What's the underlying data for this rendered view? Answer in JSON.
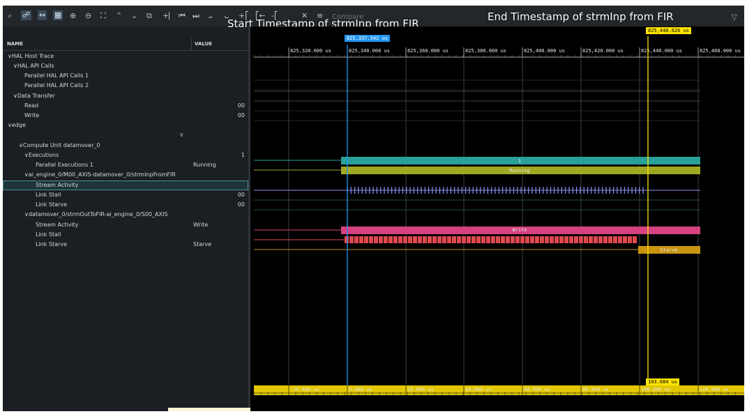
{
  "toolbar": {
    "icons": [
      "search-icon",
      "graph-icon",
      "fit-icon",
      "grid-icon",
      "zoom-in-icon",
      "zoom-out-icon",
      "zoom-fit-icon",
      "collapse-all-icon",
      "expand-all-icon",
      "copy-icon",
      "add-marker-icon",
      "prev-icon",
      "next-icon",
      "marker-icon",
      "sync-icon",
      "marker-start-icon",
      "marker-end-icon",
      "marker-remove-icon",
      "close-icon",
      "list-icon"
    ],
    "compare_label": "Compare",
    "filter_icon": "filter-icon"
  },
  "annotations": {
    "start": "Start Timestamp of strmInp from FIR",
    "end": "End Timestamp of strmInp from FIR"
  },
  "table": {
    "name_header": "NAME",
    "value_header": "VALUE",
    "rows": [
      {
        "label": "HAL Host Trace",
        "value": "",
        "num": ""
      },
      {
        "label": "HAL API Calls",
        "value": "",
        "num": ""
      },
      {
        "label": "Parallel HAL API Calls 1",
        "value": "",
        "num": ""
      },
      {
        "label": "Parallel HAL API Calls 2",
        "value": "",
        "num": ""
      },
      {
        "label": "Data Transfer",
        "value": "",
        "num": ""
      },
      {
        "label": "Read",
        "value": "",
        "num": "00"
      },
      {
        "label": "Write",
        "value": "",
        "num": "00"
      },
      {
        "label": "edge",
        "value": "",
        "num": ""
      },
      {
        "label": "Compute Unit datamover_0",
        "value": "",
        "num": ""
      },
      {
        "label": "Executions",
        "value": "",
        "num": "1"
      },
      {
        "label": "Parallel Executions 1",
        "value": "Running",
        "num": ""
      },
      {
        "label": "ai_engine_0/M00_AXIS-datamover_0/strmInpFromFIR",
        "value": "",
        "num": ""
      },
      {
        "label": "Stream Activity",
        "value": "",
        "num": ""
      },
      {
        "label": "Link Stall",
        "value": "",
        "num": "00"
      },
      {
        "label": "Link Starve",
        "value": "",
        "num": "00"
      },
      {
        "label": "datamover_0/strmOutToFIR-ai_engine_0/S00_AXIS",
        "value": "",
        "num": ""
      },
      {
        "label": "Stream Activity",
        "value": "Write",
        "num": ""
      },
      {
        "label": "Link Stall",
        "value": "",
        "num": ""
      },
      {
        "label": "Link Starve",
        "value": "Starve",
        "num": ""
      }
    ]
  },
  "timeline": {
    "top_ticks": [
      "825,320.000 us",
      "825,340.000 us",
      "825,360.000 us",
      "825,380.000 us",
      "825,400.000 us",
      "825,420.000 us",
      "825,440.000 us",
      "825,460.000 us"
    ],
    "bottom_ticks": [
      "-20.000 us",
      "0.000 us",
      "20.000 us",
      "40.000 us",
      "60.000 us",
      "80.000 us",
      "100.000 us",
      "120.000 us"
    ],
    "cursor_start": "825,337.542 us",
    "cursor_end": "825,440.626 us",
    "cursor_delta": "103.084 us",
    "bar_labels": {
      "executions": "1",
      "running": "Running",
      "write": "Write",
      "starve": "Starve"
    },
    "colors": {
      "executions": "#2aa198",
      "running": "#a0a820",
      "stream_ticks": "#8f8ff5",
      "write": "#d6417f",
      "stall": "#e0484f",
      "starve": "#c9950e",
      "cursor_start": "#2196f3",
      "cursor_end": "#fde400",
      "ruler": "#e2c700"
    }
  }
}
